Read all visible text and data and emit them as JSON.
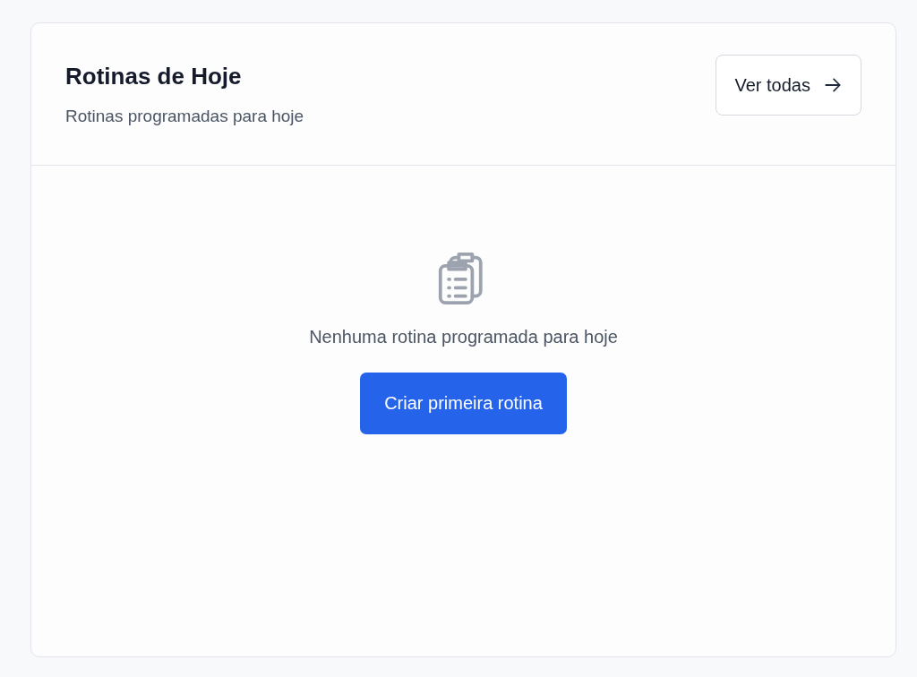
{
  "card": {
    "title": "Rotinas de Hoje",
    "subtitle": "Rotinas programadas para hoje",
    "view_all_button": "Ver todas"
  },
  "empty_state": {
    "message": "Nenhuma rotina programada para hoje",
    "create_button": "Criar primeira rotina"
  }
}
